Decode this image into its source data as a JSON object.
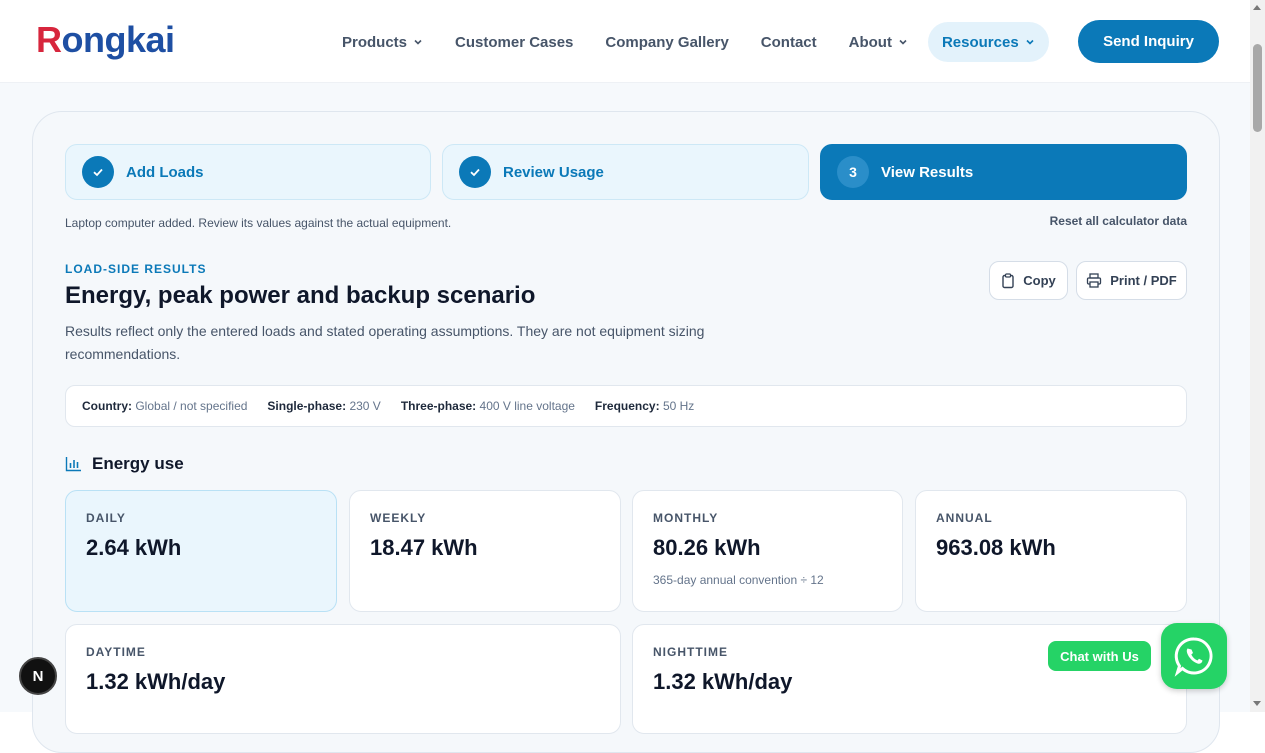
{
  "brand": {
    "logo_first": "R",
    "logo_rest": "ongkai",
    "color_primary": "#0b79b8",
    "color_logo_r": "#d7263d",
    "color_logo_text": "#1e4fa3"
  },
  "nav": {
    "items": [
      {
        "label": "Products",
        "has_dropdown": true
      },
      {
        "label": "Customer Cases",
        "has_dropdown": false
      },
      {
        "label": "Company Gallery",
        "has_dropdown": false
      },
      {
        "label": "Contact",
        "has_dropdown": false
      },
      {
        "label": "About",
        "has_dropdown": true
      },
      {
        "label": "Resources",
        "has_dropdown": true,
        "active": true
      }
    ],
    "cta": "Send Inquiry"
  },
  "steps": [
    {
      "label": "Add Loads",
      "state": "done",
      "icon": "check-icon"
    },
    {
      "label": "Review Usage",
      "state": "done",
      "icon": "check-icon"
    },
    {
      "number": "3",
      "label": "View Results",
      "state": "active"
    }
  ],
  "notice": "Laptop computer added. Review its values against the actual equipment.",
  "reset_label": "Reset all calculator data",
  "results": {
    "eyebrow": "LOAD-SIDE RESULTS",
    "title": "Energy, peak power and backup scenario",
    "description": "Results reflect only the entered loads and stated operating assumptions. They are not equipment sizing recommendations.",
    "copy_label": "Copy",
    "print_label": "Print / PDF"
  },
  "info": {
    "country_label": "Country:",
    "country_value": "Global / not specified",
    "single_label": "Single-phase:",
    "single_value": "230 V",
    "three_label": "Three-phase:",
    "three_value": "400 V line voltage",
    "freq_label": "Frequency:",
    "freq_value": "50 Hz"
  },
  "energy": {
    "heading": "Energy use",
    "cards": [
      {
        "label": "DAILY",
        "value": "2.64 kWh",
        "highlight": true
      },
      {
        "label": "WEEKLY",
        "value": "18.47 kWh"
      },
      {
        "label": "MONTHLY",
        "value": "80.26 kWh",
        "note": "365-day annual convention ÷ 12"
      },
      {
        "label": "ANNUAL",
        "value": "963.08 kWh"
      },
      {
        "label": "DAYTIME",
        "value": "1.32 kWh/day"
      },
      {
        "label": "NIGHTTIME",
        "value": "1.32 kWh/day"
      }
    ]
  },
  "widgets": {
    "next_badge": "N",
    "chat_label": "Chat with Us",
    "whatsapp_color": "#25d366"
  }
}
